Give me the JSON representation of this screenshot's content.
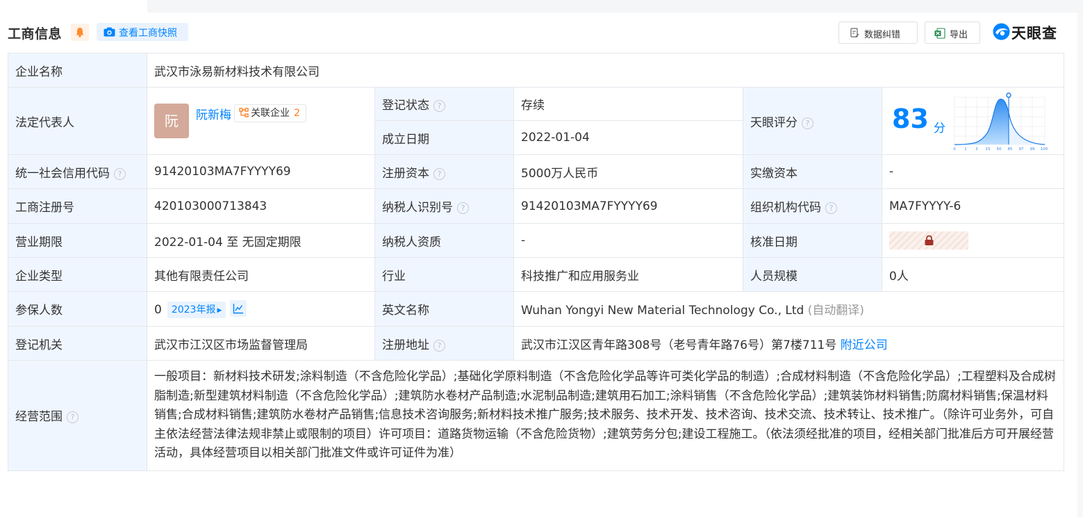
{
  "header": {
    "title": "工商信息",
    "snapshot_label": "查看工商快照",
    "correct_label": "数据纠错",
    "export_label": "导出",
    "brand": "天眼查"
  },
  "company": {
    "name_label": "企业名称",
    "name": "武汉市泳易新材料技术有限公司",
    "legal_rep_label": "法定代表人",
    "legal_avatar_char": "阮",
    "legal_rep": "阮新梅",
    "assoc_label": "关联企业",
    "assoc_count": "2",
    "reg_status_label": "登记状态",
    "reg_status": "存续",
    "found_date_label": "成立日期",
    "found_date": "2022-01-04",
    "score_label": "天眼评分",
    "score": "83",
    "score_unit": "分",
    "score_ticks": [
      "0",
      "1",
      "3",
      "15",
      "50",
      "85",
      "97",
      "99",
      "100"
    ],
    "credit_code_label": "统一社会信用代码",
    "credit_code": "91420103MA7FYYYY69",
    "reg_capital_label": "注册资本",
    "reg_capital": "5000万人民币",
    "paid_capital_label": "实缴资本",
    "paid_capital": "-",
    "reg_no_label": "工商注册号",
    "reg_no": "420103000713843",
    "taxpayer_id_label": "纳税人识别号",
    "taxpayer_id": "91420103MA7FYYYY69",
    "org_code_label": "组织机构代码",
    "org_code": "MA7FYYYY-6",
    "term_label": "营业期限",
    "term": "2022-01-04 至 无固定期限",
    "taxpayer_qual_label": "纳税人资质",
    "taxpayer_qual": "-",
    "approve_date_label": "核准日期",
    "type_label": "企业类型",
    "type": "其他有限责任公司",
    "industry_label": "行业",
    "industry": "科技推广和应用服务业",
    "staff_label": "人员规模",
    "staff": "0人",
    "insured_label": "参保人数",
    "insured": "0",
    "annual_report_tag": "2023年报",
    "english_name_label": "英文名称",
    "english_name": "Wuhan Yongyi New Material Technology Co., Ltd",
    "english_name_note": "(自动翻译)",
    "authority_label": "登记机关",
    "authority": "武汉市江汉区市场监督管理局",
    "address_label": "注册地址",
    "address": "武汉市江汉区青年路308号（老号青年路76号）第7楼711号",
    "nearby_label": "附近公司",
    "scope_label": "经营范围",
    "scope": "一般项目：新材料技术研发;涂料制造（不含危险化学品）;基础化学原料制造（不含危险化学品等许可类化学品的制造）;合成材料制造（不含危险化学品）;工程塑料及合成树脂制造;新型建筑材料制造（不含危险化学品）;建筑防水卷材产品制造;水泥制品制造;建筑用石加工;涂料销售（不含危险化学品）;建筑装饰材料销售;防腐材料销售;保温材料销售;合成材料销售;建筑防水卷材产品销售;信息技术咨询服务;新材料技术推广服务;技术服务、技术开发、技术咨询、技术交流、技术转让、技术推广。（除许可业务外，可自主依法经营法律法规非禁止或限制的项目）许可项目：道路货物运输（不含危险货物）;建筑劳务分包;建设工程施工。（依法须经批准的项目，经相关部门批准后方可开展经营活动，具体经营项目以相关部门批准文件或许可证件为准）"
  },
  "colors": {
    "accent": "#0084ff",
    "status_green": "#17a05d",
    "label_bg": "#f0f6ff",
    "border": "#e4e7ec"
  }
}
